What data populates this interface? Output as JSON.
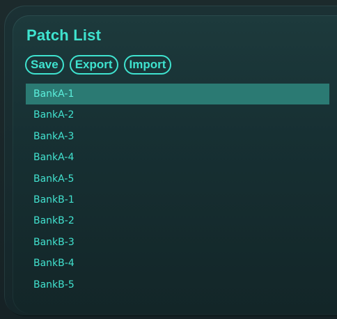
{
  "panel": {
    "title": "Patch List"
  },
  "toolbar": {
    "save_label": "Save",
    "export_label": "Export",
    "import_label": "Import"
  },
  "patches": [
    {
      "label": "BankA-1",
      "selected": true
    },
    {
      "label": "BankA-2",
      "selected": false
    },
    {
      "label": "BankA-3",
      "selected": false
    },
    {
      "label": "BankA-4",
      "selected": false
    },
    {
      "label": "BankA-5",
      "selected": false
    },
    {
      "label": "BankB-1",
      "selected": false
    },
    {
      "label": "BankB-2",
      "selected": false
    },
    {
      "label": "BankB-3",
      "selected": false
    },
    {
      "label": "BankB-4",
      "selected": false
    },
    {
      "label": "BankB-5",
      "selected": false
    }
  ],
  "colors": {
    "accent": "#3fe3cf",
    "selection": "#2b7a73",
    "panel_background": "#1a3335"
  }
}
